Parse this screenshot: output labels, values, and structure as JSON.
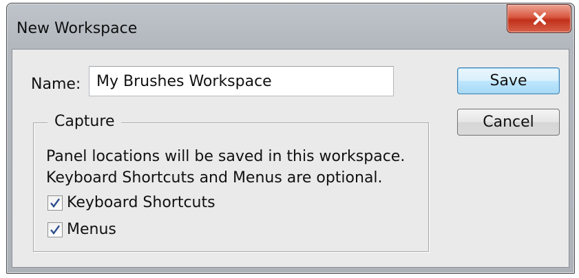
{
  "window": {
    "title": "New Workspace",
    "close_icon": "close-x-icon",
    "close_color": "#c1301a"
  },
  "form": {
    "name_label": "Name:",
    "name_value": "My Brushes Workspace"
  },
  "buttons": {
    "save": "Save",
    "cancel": "Cancel"
  },
  "capture": {
    "legend": "Capture",
    "description_line1": "Panel locations will be saved in this workspace.",
    "description_line2": "Keyboard Shortcuts and Menus are optional.",
    "options": [
      {
        "label": "Keyboard Shortcuts",
        "checked": true
      },
      {
        "label": "Menus",
        "checked": true
      }
    ]
  },
  "colors": {
    "default_button_border": "#3c7fb1",
    "check_mark": "#2d4f8e"
  }
}
